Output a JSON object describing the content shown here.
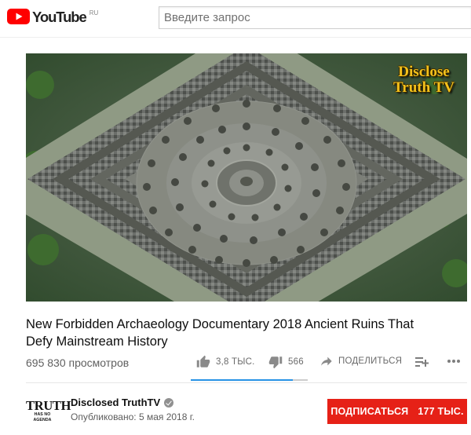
{
  "header": {
    "logo_text": "YouTube",
    "region": "RU",
    "search_placeholder": "Введите запрос"
  },
  "player": {
    "watermark_line1": "Disclose",
    "watermark_line2": "Truth TV"
  },
  "video": {
    "title": "New Forbidden Archaeology Documentary 2018 Ancient Ruins That Defy Mainstream History",
    "views": "695 830 просмотров"
  },
  "actions": {
    "likes": "3,8 ТЫС.",
    "dislikes": "566",
    "share_label": "ПОДЕЛИТЬСЯ",
    "like_ratio": 0.87
  },
  "channel": {
    "avatar_line1": "TRUTH",
    "avatar_line2": "HAS NO AGENDA",
    "name": "Disclosed TruthTV",
    "published": "Опубликовано: 5 мая 2018 г.",
    "subscribe_label": "ПОДПИСАТЬСЯ",
    "subscriber_count": "177 ТЫС."
  },
  "colors": {
    "brand_red": "#e62117",
    "accent_blue": "#2793e6",
    "watermark_gold": "#f3c11c"
  },
  "icons": [
    "youtube-logo-icon",
    "thumbs-up-icon",
    "thumbs-down-icon",
    "share-icon",
    "add-to-playlist-icon",
    "more-icon",
    "verified-icon"
  ]
}
